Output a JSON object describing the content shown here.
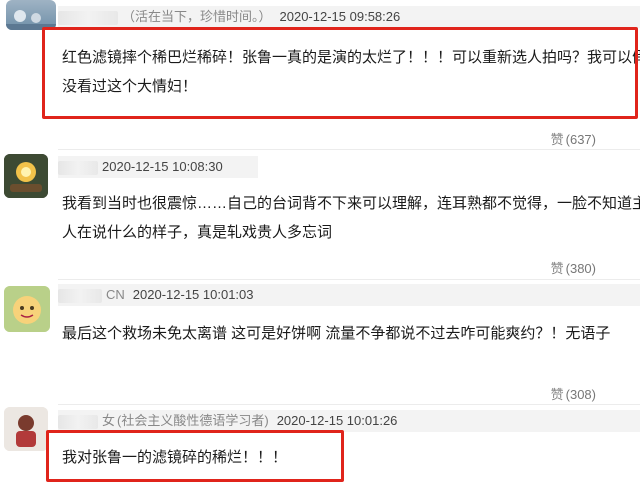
{
  "comments": [
    {
      "user": "",
      "user_tag": "（活在当下，珍惜时间。）",
      "time": "2020-12-15 09:58:26",
      "text_lines": [
        "红色滤镜摔个稀巴烂稀碎！张鲁一真的是演的太烂了！！！可以重新选人拍吗？我可以假装",
        "没看过这个大情妇！"
      ],
      "likes_icon": "赞",
      "likes": "(637)"
    },
    {
      "user": "",
      "user_tag": "",
      "time": "2020-12-15 10:08:30",
      "text_lines": [
        "我看到当时也很震惊……自己的台词背不下来可以理解，连耳熟都不觉得，一脸不知道主持",
        "人在说什么的样子，真是轧戏贵人多忘词"
      ],
      "likes_icon": "赞",
      "likes": "(380)"
    },
    {
      "user": "CN",
      "user_tag": "",
      "time": "2020-12-15 10:01:03",
      "text_lines": [
        "最后这个救场未免太离谱 这可是好饼啊 流量不争都说不过去咋可能爽约？！无语子"
      ],
      "likes_icon": "赞",
      "likes": "(308)"
    },
    {
      "user": "女",
      "user_tag": "(社会主义酸性德语学习者)",
      "time": "2020-12-15 10:01:26",
      "text_lines": [
        "我对张鲁一的滤镜碎的稀烂！！！"
      ],
      "likes_icon": "",
      "likes": ""
    }
  ],
  "colors": {
    "highlight": "#e0241b",
    "meta_bg": "#f3f3f3"
  }
}
